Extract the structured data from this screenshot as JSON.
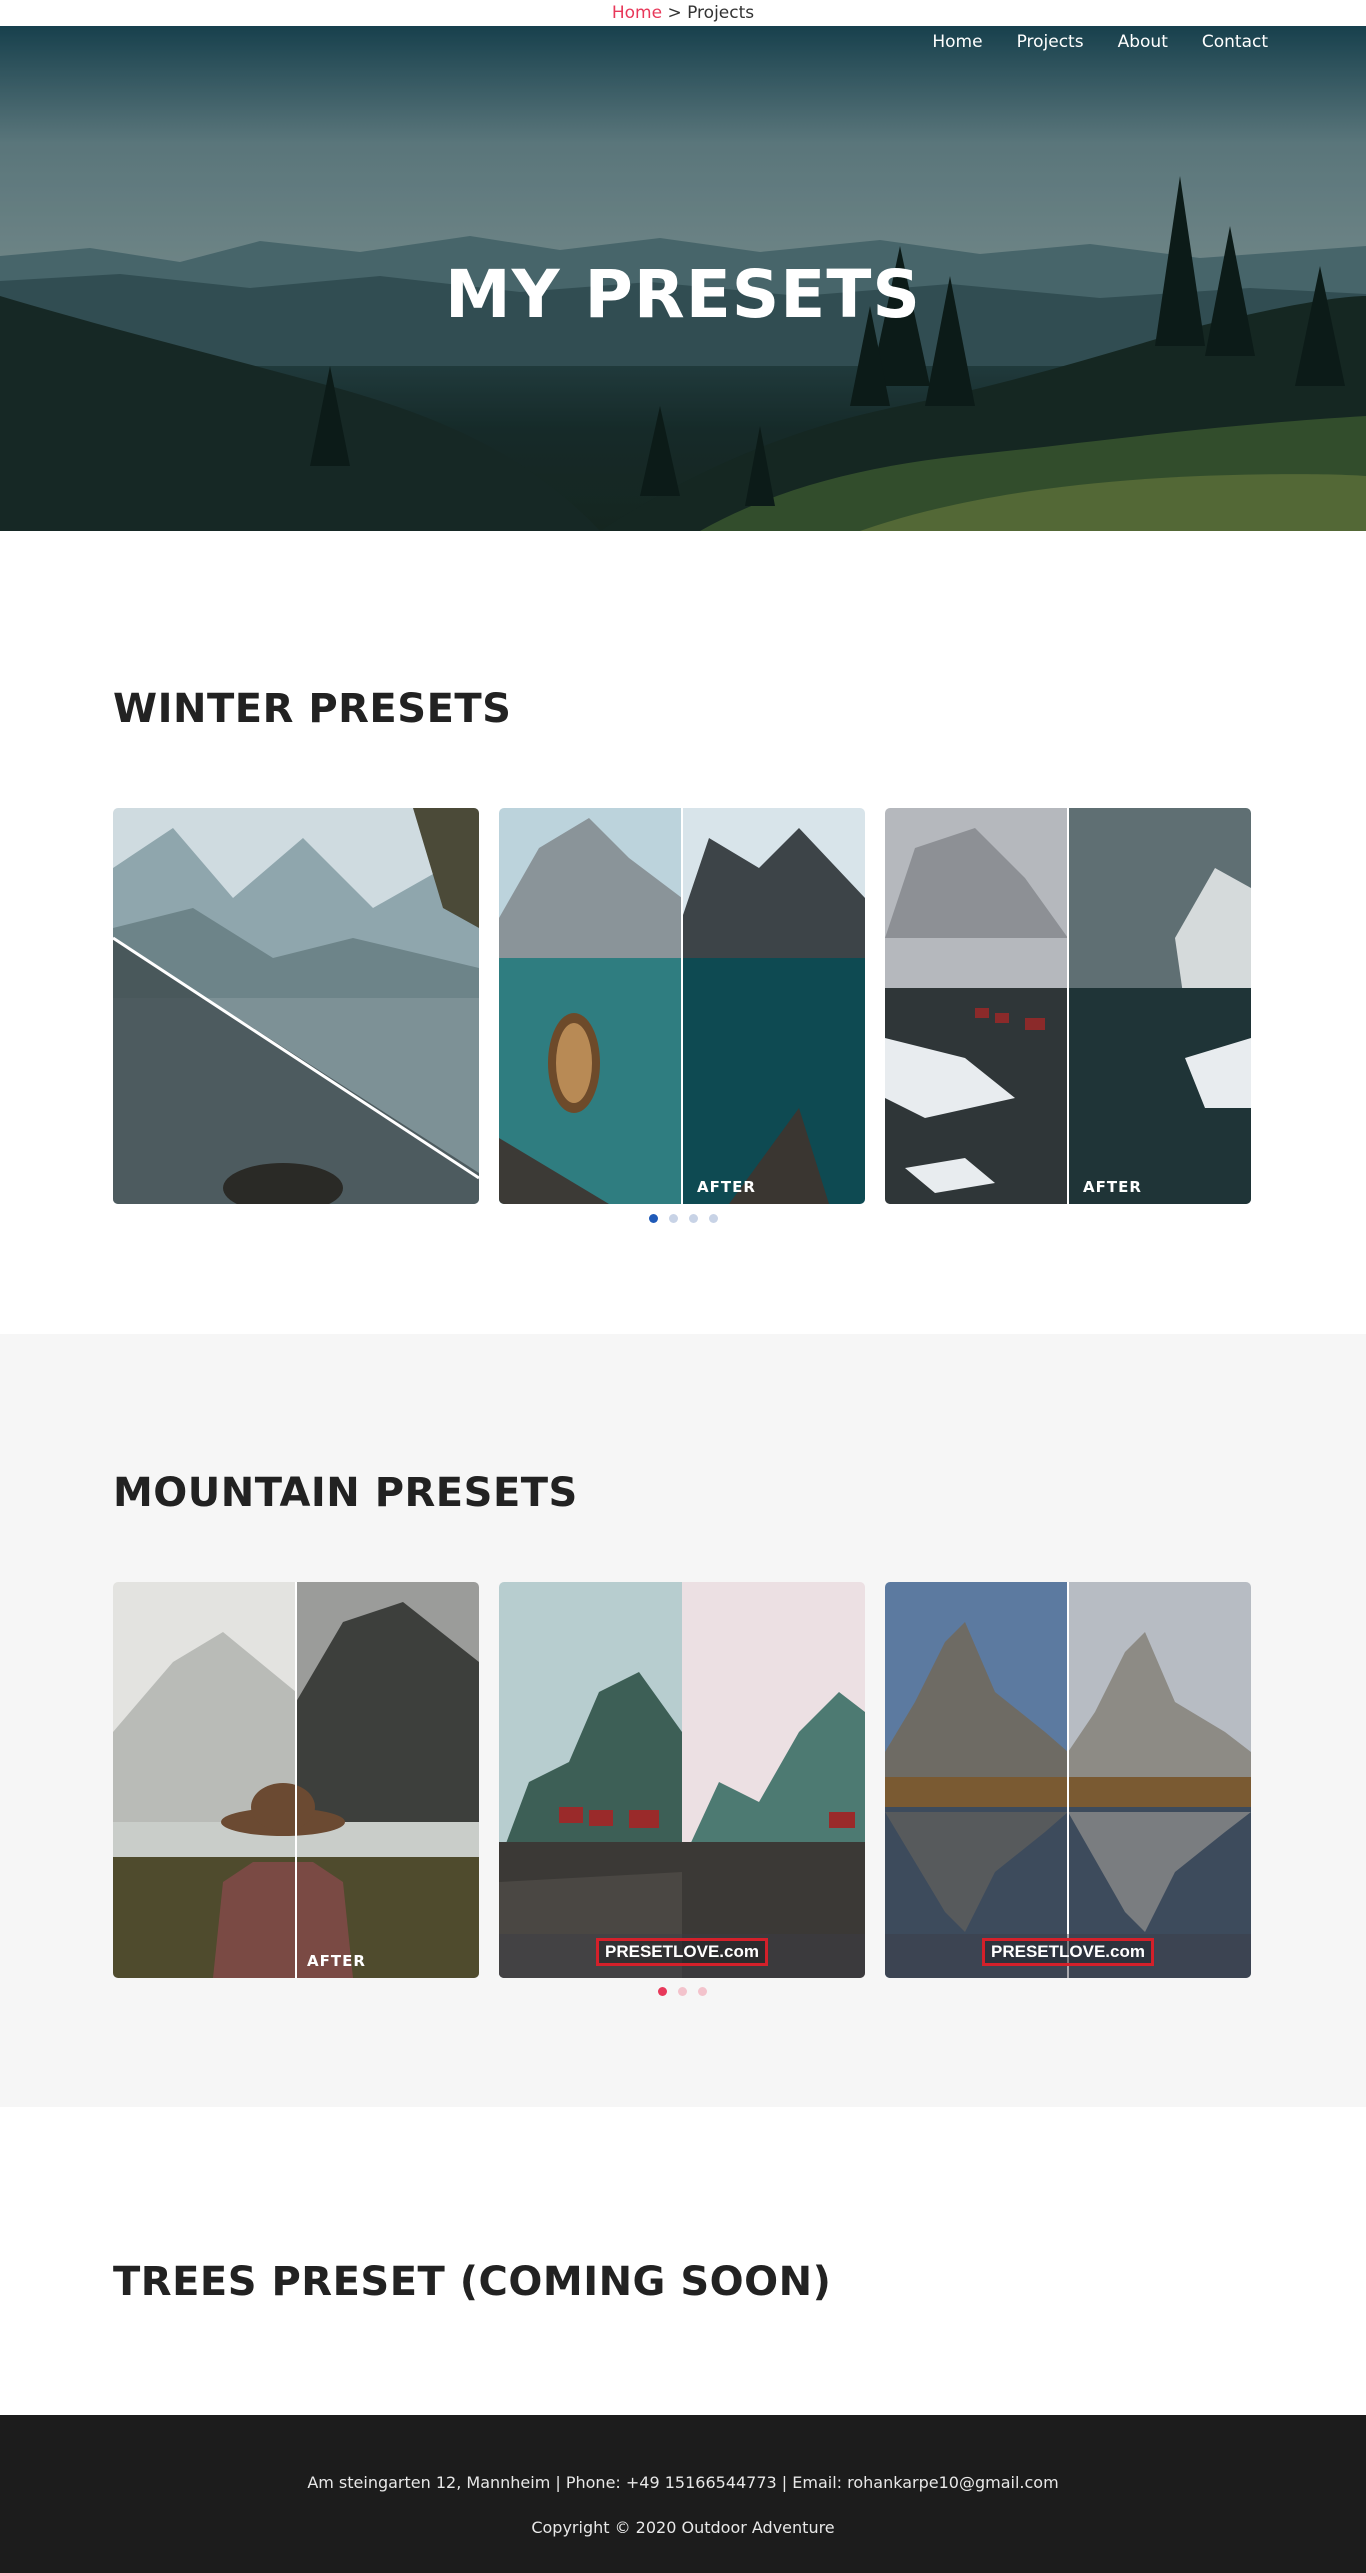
{
  "breadcrumb": {
    "home": "Home",
    "separator": ">",
    "current": "Projects"
  },
  "nav": {
    "items": [
      "Home",
      "Projects",
      "About",
      "Contact"
    ]
  },
  "hero": {
    "title": "MY PRESETS"
  },
  "winter": {
    "title": "WINTER PRESETS",
    "cards": [
      {
        "after": ""
      },
      {
        "after": "AFTER"
      },
      {
        "after": "AFTER"
      }
    ],
    "pagination": {
      "count": 4,
      "active": 1,
      "color": "#1f5ab8"
    }
  },
  "mountain": {
    "title": "MOUNTAIN PRESETS",
    "cards": [
      {
        "after": "AFTER"
      },
      {
        "watermark": "PRESETLOVE.com"
      },
      {
        "watermark": "PRESETLOVE.com"
      }
    ],
    "pagination": {
      "count": 3,
      "active": 1,
      "color": "#e8385a"
    }
  },
  "trees": {
    "title": "TREES PRESET (COMING SOON)"
  },
  "footer": {
    "address": "Am steingarten 12, Mannheim | Phone: +49 15166544773 | Email: rohankarpe10@gmail.com",
    "copyright": "Copyright © 2020 Outdoor Adventure"
  },
  "colors": {
    "accent": "#e8385a",
    "footer_bg": "#1c1c1c",
    "alt_section_bg": "#f6f6f6"
  }
}
